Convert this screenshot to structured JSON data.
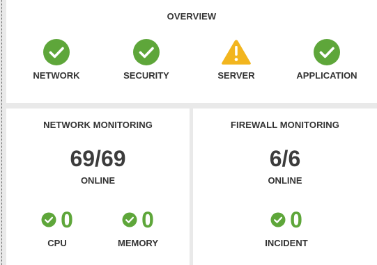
{
  "colors": {
    "ok": "#5ea63a",
    "warning": "#f2b51e",
    "text": "#333333"
  },
  "overview": {
    "title": "OVERVIEW",
    "items": [
      {
        "label": "NETWORK",
        "status": "ok",
        "icon": "check-circle-icon"
      },
      {
        "label": "SECURITY",
        "status": "ok",
        "icon": "check-circle-icon"
      },
      {
        "label": "SERVER",
        "status": "warning",
        "icon": "warning-triangle-icon"
      },
      {
        "label": "APPLICATION",
        "status": "ok",
        "icon": "check-circle-icon"
      }
    ]
  },
  "network_monitoring": {
    "title": "NETWORK MONITORING",
    "count": "69/69",
    "online_label": "ONLINE",
    "metrics": [
      {
        "label": "CPU",
        "value": "0",
        "icon": "check-circle-icon"
      },
      {
        "label": "MEMORY",
        "value": "0",
        "icon": "check-circle-icon"
      }
    ]
  },
  "firewall_monitoring": {
    "title": "FIREWALL MONITORING",
    "count": "6/6",
    "online_label": "ONLINE",
    "metrics": [
      {
        "label": "INCIDENT",
        "value": "0",
        "icon": "check-circle-icon"
      }
    ]
  }
}
